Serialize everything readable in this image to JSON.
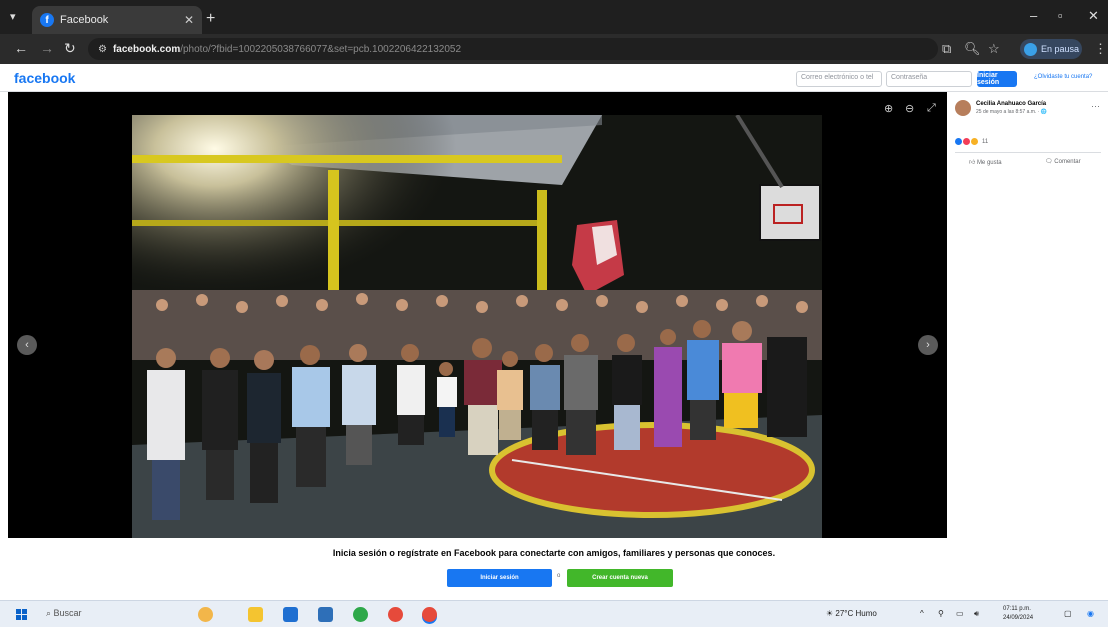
{
  "browser": {
    "tab_title": "Facebook",
    "url_site": "facebook.com",
    "url_path": "/photo/?fbid=1002205038766077&set=pcb.1002206422132052",
    "profile_label": "En pausa"
  },
  "fb_header": {
    "logo": "facebook",
    "email_placeholder": "Correo electrónico o tel",
    "password_placeholder": "Contraseña",
    "login_label": "Iniciar sesión",
    "forgot_label": "¿Olvidaste tu cuenta?"
  },
  "post": {
    "author": "Cecilia Anahuaco García",
    "date": "25 de mayo a las 8:57 a.m. · 🌐",
    "reaction_count": "11",
    "like_label": "Me gusta",
    "comment_label": "Comentar"
  },
  "banner": {
    "text": "Inicia sesión o regístrate en Facebook para conectarte con amigos, familiares y personas que conoces.",
    "login_label": "Iniciar sesión",
    "or_label": "o",
    "create_label": "Crear cuenta nueva"
  },
  "taskbar": {
    "search_label": "Buscar",
    "weather": "27°C Humo",
    "time": "07:11 p.m.",
    "date": "24/09/2024"
  },
  "colors": {
    "fb_blue": "#1877f2",
    "create_green": "#42b72a"
  }
}
